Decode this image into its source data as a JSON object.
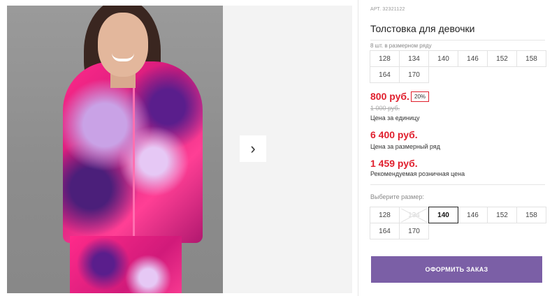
{
  "gallery": {
    "photo_alt": "Толстовка для девочки",
    "next_arrow": "›"
  },
  "product": {
    "sku": "АРТ. 32321122",
    "title": "Толстовка для девочки",
    "set_label": "8 шт. в размерном ряду",
    "set_sizes": [
      "128",
      "134",
      "140",
      "146",
      "152",
      "158",
      "164",
      "170"
    ],
    "price": "800 руб.",
    "discount": "20%",
    "old_price": "1 000 руб.",
    "price_caption": "Цена за единицу",
    "set_price": "6 400 руб.",
    "set_price_caption": "Цена за размерный ряд",
    "retail_price": "1 459 руб.",
    "retail_caption": "Рекомендуемая розничная цена",
    "choose_label": "Выберите размер:",
    "choose_sizes": [
      {
        "label": "128",
        "state": "available"
      },
      {
        "label": "134",
        "state": "unavailable"
      },
      {
        "label": "140",
        "state": "selected"
      },
      {
        "label": "146",
        "state": "available"
      },
      {
        "label": "152",
        "state": "available"
      },
      {
        "label": "158",
        "state": "available"
      },
      {
        "label": "164",
        "state": "available"
      },
      {
        "label": "170",
        "state": "available"
      }
    ],
    "order_button": "ОФОРМИТЬ ЗАКАЗ"
  },
  "colors": {
    "price_red": "#e01f2d",
    "order_button_bg": "#7b5fa6"
  }
}
